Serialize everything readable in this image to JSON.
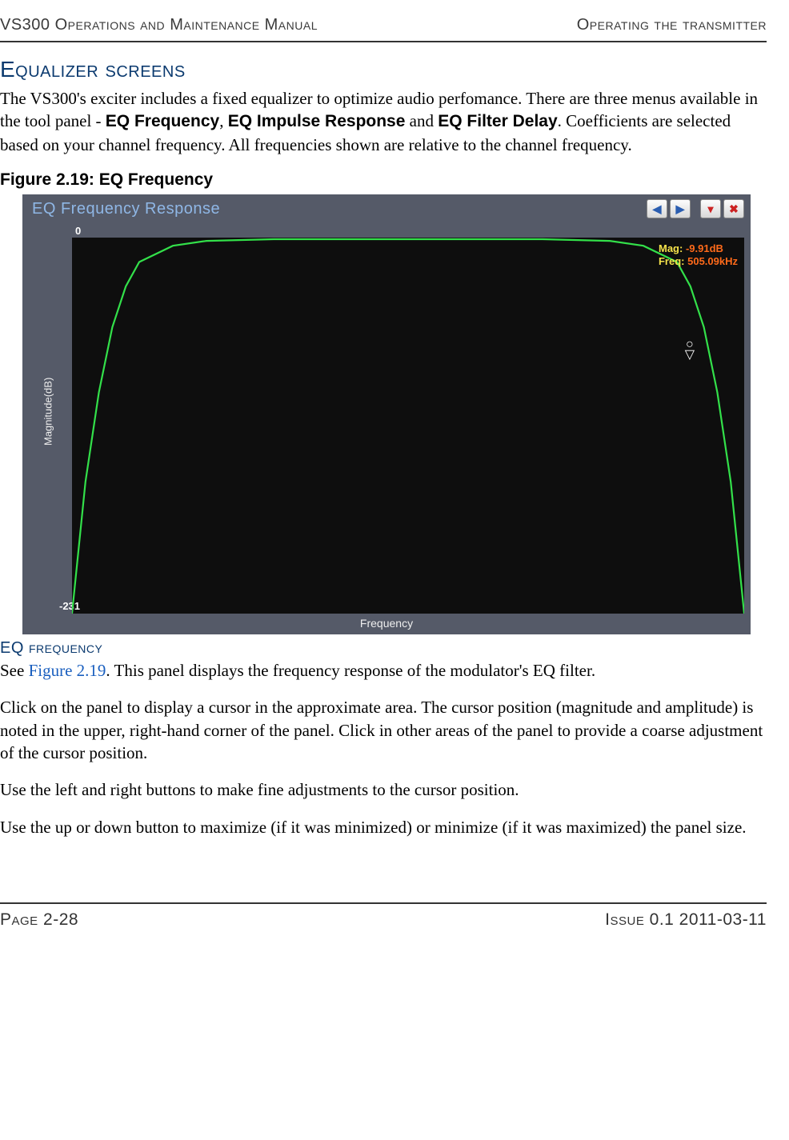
{
  "header": {
    "left": "VS300 Operations and Maintenance Manual",
    "right": "Operating the transmitter"
  },
  "section_title": "Equalizer screens",
  "intro": {
    "p1_a": "The VS300's exciter includes a fixed equalizer to optimize audio perfomance. There are three menus available in the tool panel - ",
    "b1": "EQ Frequency",
    "p1_b": ", ",
    "b2": "EQ Impulse Response",
    "p1_c": " and ",
    "b3": "EQ Filter Delay",
    "p1_d": ". Coefficients are selected based on your channel frequency. All frequencies shown are relative to the channel frequency."
  },
  "figure_caption": "Figure 2.19: EQ Frequency",
  "chart_data": {
    "type": "line",
    "title": "EQ Frequency Response",
    "xlabel": "Frequency",
    "ylabel": "Magnitude(dB)",
    "ylim": [
      -231,
      0
    ],
    "y_ticks_shown": [
      "0",
      "-231"
    ],
    "series": [
      {
        "name": "EQ Frequency Response",
        "x_fraction": [
          0.0,
          0.02,
          0.04,
          0.06,
          0.08,
          0.1,
          0.15,
          0.2,
          0.3,
          0.4,
          0.5,
          0.6,
          0.7,
          0.8,
          0.85,
          0.9,
          0.92,
          0.94,
          0.96,
          0.98,
          1.0
        ],
        "values_db": [
          -231,
          -150,
          -95,
          -55,
          -30,
          -15,
          -5,
          -2,
          -1,
          -1,
          -1,
          -1,
          -1,
          -2,
          -5,
          -15,
          -30,
          -55,
          -95,
          -150,
          -231
        ]
      }
    ],
    "cursor": {
      "mag_label": "Mag:",
      "mag_value": "-9.91dB",
      "freq_label": "Freq:",
      "freq_value": "505.09kHz"
    }
  },
  "sub_title": "EQ frequency",
  "body": {
    "p2_a": "See ",
    "p2_link": "Figure 2.19",
    "p2_b": ". This panel displays the frequency response of the modulator's EQ filter.",
    "p3": "Click on the panel to display a cursor in the approximate area. The cursor position (magnitude and amplitude) is noted in the upper, right-hand corner of the panel. Click in other areas of the panel to provide a coarse adjustment of the cursor position.",
    "p4": "Use the left and right buttons to make fine adjustments to the cursor position.",
    "p5": "Use the up or down button to maximize (if it was minimized) or minimize (if it was maximized) the panel size."
  },
  "footer": {
    "left": "Page 2-28",
    "right": "Issue 0.1  2011-03-11"
  },
  "icons": {
    "left": "◀",
    "right": "▶",
    "down": "▾",
    "close": "✖"
  }
}
